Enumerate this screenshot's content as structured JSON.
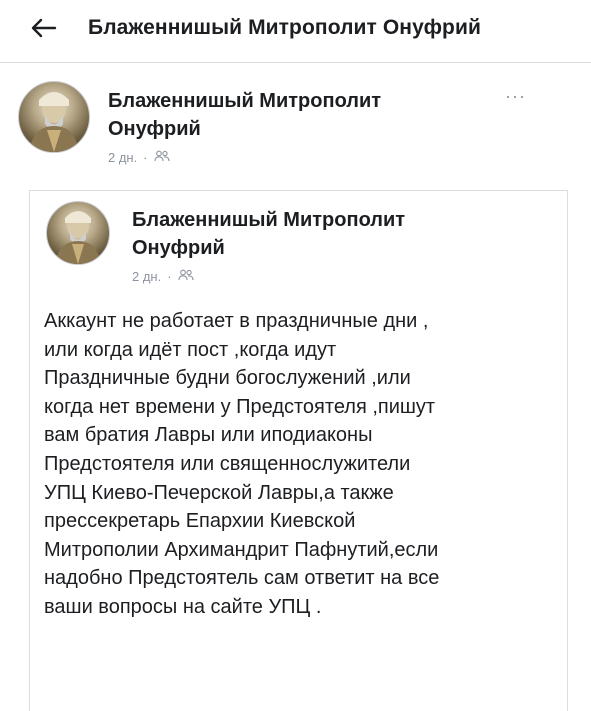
{
  "header": {
    "back_icon": "arrow-left-icon",
    "title": "Блаженнишый Митрополит Онуфрий"
  },
  "outer_post": {
    "author": "Блаженнишый Митрополит Онуфрий",
    "time": "2 дн.",
    "separator": "·",
    "audience_icon": "friends-icon",
    "more_label": "···"
  },
  "shared_post": {
    "author": "Блаженнишый Митрополит Онуфрий",
    "time": "2 дн.",
    "separator": "·",
    "audience_icon": "friends-icon",
    "text_lines": [
      "Аккаунт не работает в праздничные дни ,",
      "или когда идёт пост ,когда идут",
      "Праздничные будни богослужений ,или",
      "когда нет времени у Предстоятеля ,пишут",
      "вам братия Лавры или иподиаконы",
      "Предстоятеля или священнослужители",
      "УПЦ Киево-Печерской Лавры,а также",
      "прессекретарь Епархии Киевской",
      "Митрополии Архимандрит Пафнутий,если",
      "надобно Предстоятель сам ответит на все",
      "ваши вопросы на сайте УПЦ ."
    ]
  },
  "colors": {
    "text_primary": "#1c1e21",
    "text_secondary": "#8d949e",
    "divider": "#dadde1",
    "background": "#ffffff"
  }
}
